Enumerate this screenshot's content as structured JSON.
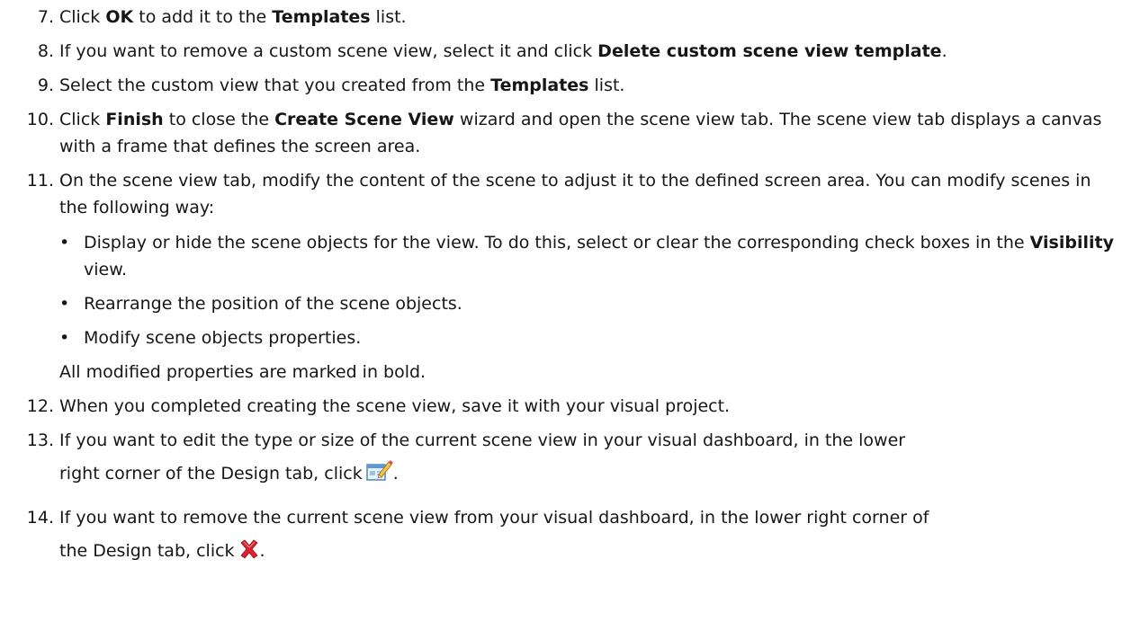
{
  "steps": {
    "s7": {
      "num": "7.",
      "t1": "Click ",
      "b1": "OK",
      "t2": " to add it to the ",
      "b2": "Templates",
      "t3": " list."
    },
    "s8": {
      "num": "8.",
      "t1": "If you want to remove a custom scene view, select it and click ",
      "b1": "Delete custom scene view template",
      "t2": "."
    },
    "s9": {
      "num": "9.",
      "t1": "Select the custom view that you created from the ",
      "b1": "Templates",
      "t2": " list."
    },
    "s10": {
      "num": "10.",
      "t1": "Click ",
      "b1": "Finish",
      "t2": " to close the ",
      "b2": "Create Scene View",
      "t3": " wizard and open the scene view tab. The scene view tab displays a canvas with a frame that defines the screen area."
    },
    "s11": {
      "num": "11.",
      "t1": "On the scene view tab, modify the content of the scene to adjust it to the defined screen area. You can modify scenes in the following way:",
      "bullet1": {
        "t1": "Display or hide the scene objects for the view. To do this, select or clear the corresponding check boxes in the ",
        "b1": "Visibility",
        "t2": " view."
      },
      "bullet2": "Rearrange the position of the scene objects.",
      "bullet3": "Modify scene objects properties.",
      "note": "All modified properties are marked in bold."
    },
    "s12": {
      "num": "12.",
      "t1": "When you completed creating the scene view, save it with your visual project."
    },
    "s13": {
      "num": "13.",
      "line1": "If you want to edit the type or size of the current scene view in your visual dashboard, in the lower",
      "line2": "right corner of the Design tab, click",
      "end": "."
    },
    "s14": {
      "num": "14.",
      "line1": "If you want to remove the current scene view from your visual dashboard, in the lower right corner of",
      "line2": "the Design tab, click",
      "end": "."
    }
  },
  "icons": {
    "edit": "edit-scene-view-icon",
    "delete": "delete-scene-view-icon"
  },
  "colors": {
    "text": "#161616",
    "delete_red": "#d9232e"
  }
}
